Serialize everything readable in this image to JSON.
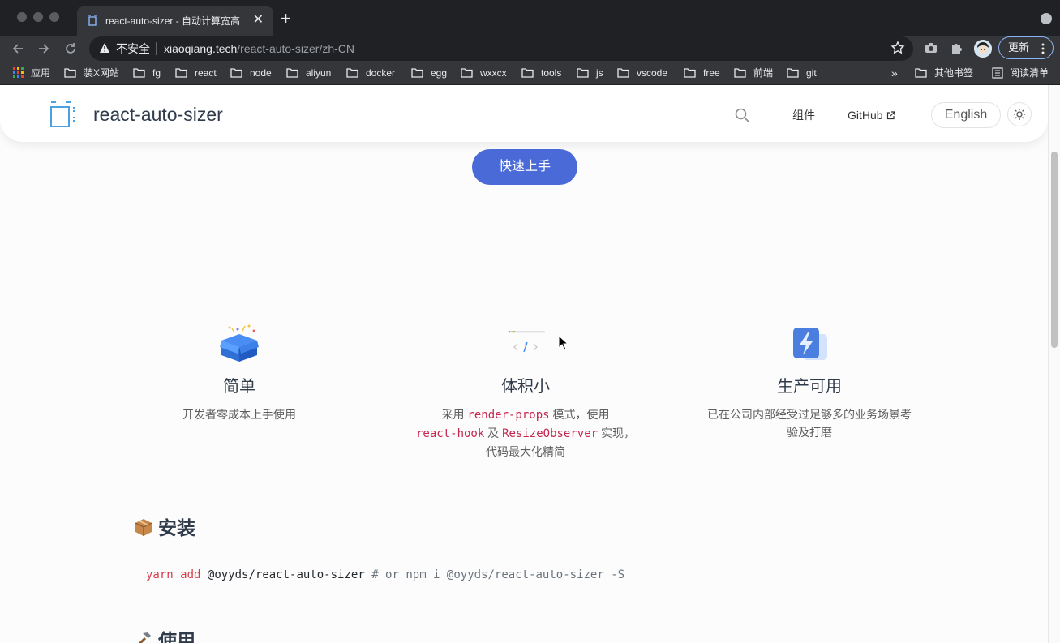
{
  "browser": {
    "tab": {
      "title": "react-auto-sizer - 自动计算宽高",
      "close_label": "✕"
    },
    "new_tab_label": "+",
    "security_label": "不安全",
    "url_host": "xiaoqiang.tech",
    "url_path": "/react-auto-sizer/zh-CN",
    "update_label": "更新",
    "bookmarks": [
      "应用",
      "装X网站",
      "fg",
      "react",
      "node",
      "aliyun",
      "docker",
      "egg",
      "wxxcx",
      "tools",
      "js",
      "vscode",
      "free",
      "前端",
      "git"
    ],
    "more_bookmarks": "»",
    "other_bookmarks": "其他书签",
    "reading_list": "阅读清单"
  },
  "site": {
    "title": "react-auto-sizer",
    "nav": {
      "components": "组件",
      "github": "GitHub"
    },
    "lang_label": "English",
    "cta_label": "快速上手"
  },
  "features": [
    {
      "title": "简单",
      "desc": "开发者零成本上手使用"
    },
    {
      "title": "体积小",
      "desc_parts": [
        "采用 ",
        "render-props",
        " 模式，使用 ",
        "react-hook",
        " 及 ",
        "ResizeObserver",
        " 实现，代码最大化精简"
      ]
    },
    {
      "title": "生产可用",
      "desc": "已在公司内部经受过足够多的业务场景考验及打磨"
    }
  ],
  "install": {
    "heading": "安装",
    "cmd_kw1": "yarn",
    "cmd_kw2": "add",
    "cmd_pkg": "@oyyds/react-auto-sizer",
    "cmd_comment": "# or npm i @oyyds/react-auto-sizer -S"
  },
  "usage": {
    "heading": "使用"
  },
  "colors": {
    "accent": "#4a6bd7",
    "code": "#c7254e",
    "title": "#2f3a4a"
  }
}
